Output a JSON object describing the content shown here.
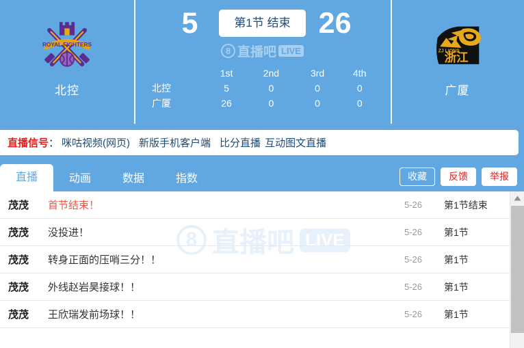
{
  "scoreboard": {
    "home_team": {
      "name": "北控",
      "score": "5",
      "logo_icon": "royal-fighters-logo",
      "logo_text": "ROYAL FIGHTERS"
    },
    "away_team": {
      "name": "广厦",
      "score": "26",
      "logo_icon": "zj-lions-logo",
      "logo_text": "ZJ LIONS"
    },
    "period_status": "第1节 结束",
    "watermark": {
      "badge": "8",
      "text": "直播吧",
      "live": "LIVE"
    },
    "quarter_table": {
      "headers": [
        "",
        "1st",
        "2nd",
        "3rd",
        "4th"
      ],
      "rows": [
        {
          "label": "北控",
          "values": [
            "5",
            "0",
            "0",
            "0"
          ]
        },
        {
          "label": "广厦",
          "values": [
            "26",
            "0",
            "0",
            "0"
          ]
        }
      ]
    }
  },
  "signal_bar": {
    "label": "直播信号",
    "colon": "：",
    "links": [
      "咪咕视频(网页)",
      "新版手机客户端",
      "比分直播",
      "互动图文直播"
    ]
  },
  "tabbar": {
    "tabs": [
      {
        "label": "直播",
        "active": true
      },
      {
        "label": "动画",
        "active": false
      },
      {
        "label": "数据",
        "active": false
      },
      {
        "label": "指数",
        "active": false
      }
    ],
    "actions": [
      {
        "label": "收藏",
        "style": "outline"
      },
      {
        "label": "反馈",
        "style": "white"
      },
      {
        "label": "举报",
        "style": "white"
      }
    ]
  },
  "commentary": {
    "rows": [
      {
        "author": "茂茂",
        "text": "首节结束！",
        "highlight": true,
        "score": "5-26",
        "period": "第1节结束"
      },
      {
        "author": "茂茂",
        "text": "没投进！",
        "highlight": false,
        "score": "5-26",
        "period": "第1节"
      },
      {
        "author": "茂茂",
        "text": "转身正面的压哨三分！！",
        "highlight": false,
        "score": "5-26",
        "period": "第1节"
      },
      {
        "author": "茂茂",
        "text": "外线赵岩昊接球！！",
        "highlight": false,
        "score": "5-26",
        "period": "第1节"
      },
      {
        "author": "茂茂",
        "text": "王欣瑞发前场球！！",
        "highlight": false,
        "score": "5-26",
        "period": "第1节"
      }
    ]
  },
  "body_watermark": {
    "badge": "8",
    "text": "直播吧",
    "live": "LIVE"
  },
  "colors": {
    "brand_blue": "#61a8e3",
    "accent_red": "#e02020",
    "highlight_red": "#e8594a",
    "chip_text": "#1e4b78",
    "link": "#1e4b78",
    "muted": "#999999",
    "logo_gold": "#e8a81c",
    "logo_purple": "#5b2d8e"
  }
}
